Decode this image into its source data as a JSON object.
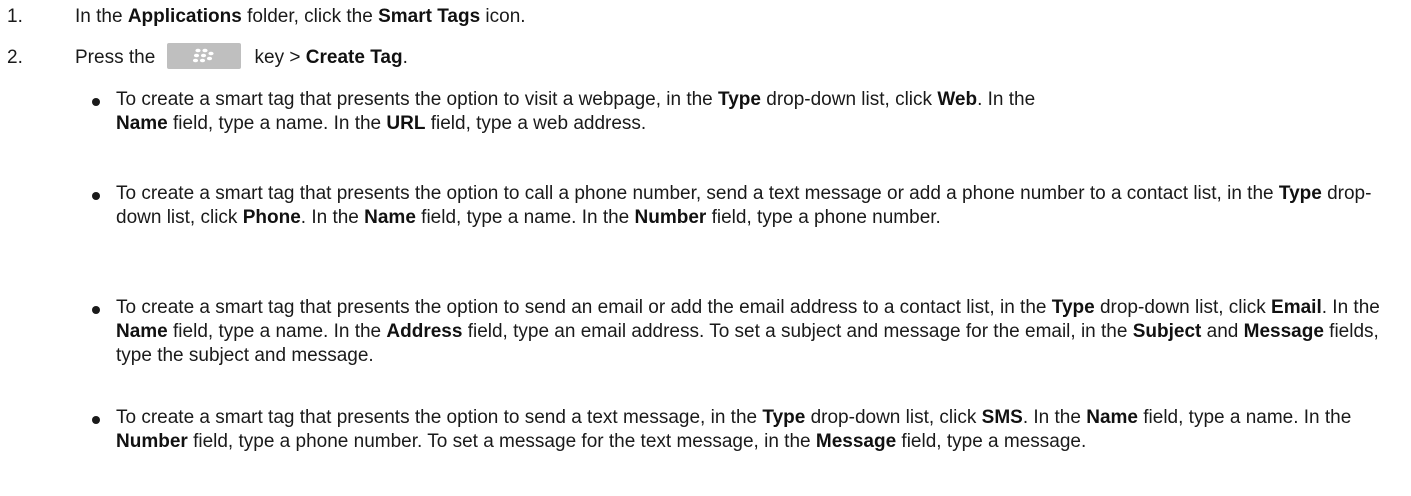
{
  "steps": [
    {
      "number": "1.",
      "parts": [
        "In the ",
        "Applications",
        " folder, click the ",
        "Smart Tags",
        " icon."
      ]
    },
    {
      "number": "2.",
      "pre": "Press the",
      "key_icon": "blackberry-menu-key-icon",
      "post": " key > ",
      "action": "Create Tag",
      "end": "."
    }
  ],
  "bullets": [
    {
      "parts": [
        "To create a smart tag that presents the option to visit a webpage, in the ",
        "Type",
        " drop-down list, click ",
        "Web",
        ". In the ",
        "Name",
        " field, type a name. In the ",
        "URL",
        " field, type a web address."
      ]
    },
    {
      "parts": [
        "To create a smart tag that presents the option to call a phone number, send a text message or add a phone number to a contact list, in the ",
        "Type",
        " drop-down list, click ",
        "Phone",
        ". In the ",
        "Name",
        " field, type a name. In the ",
        "Number",
        " field, type a phone number."
      ]
    },
    {
      "parts": [
        "To create a smart tag that presents the option to send an email or add the email address to a contact list, in the ",
        "Type",
        " drop-down list, click ",
        "Email",
        ". In the ",
        "Name",
        " field, type a name. In the ",
        "Address",
        " field, type an email address. To set a subject and message for the email, in the ",
        "Subject",
        " and ",
        "Message",
        " fields, type the subject and message."
      ]
    },
    {
      "parts": [
        "To create a smart tag that presents the option to send a text message, in the ",
        "Type",
        " drop-down list, click ",
        "SMS",
        ". In the ",
        "Name",
        " field, type a name. In the ",
        "Number",
        " field, type a phone number. To set a message for the text message, in the ",
        "Message",
        " field, type a message."
      ]
    }
  ],
  "colors": {
    "text": "#1a1a1a",
    "key_background": "#bfbfbf",
    "key_glyph": "#ffffff"
  }
}
